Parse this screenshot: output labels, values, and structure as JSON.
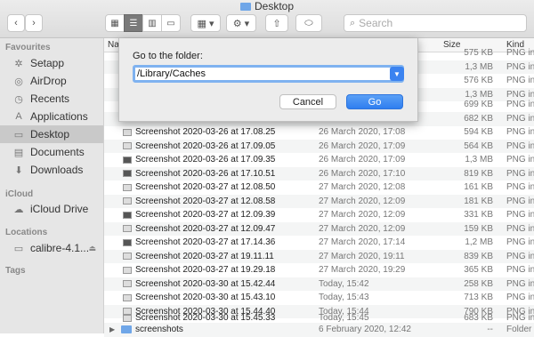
{
  "window": {
    "title": "Desktop"
  },
  "toolbar": {
    "back": "‹",
    "forward": "›",
    "search_placeholder": "Search"
  },
  "sidebar": {
    "favourites_header": "Favourites",
    "favourites": [
      {
        "label": "Setapp",
        "icon": "setapp-icon"
      },
      {
        "label": "AirDrop",
        "icon": "airdrop-icon"
      },
      {
        "label": "Recents",
        "icon": "recents-icon"
      },
      {
        "label": "Applications",
        "icon": "applications-icon"
      },
      {
        "label": "Desktop",
        "icon": "desktop-icon"
      },
      {
        "label": "Documents",
        "icon": "documents-icon"
      },
      {
        "label": "Downloads",
        "icon": "downloads-icon"
      }
    ],
    "icloud_header": "iCloud",
    "icloud_drive": "iCloud Drive",
    "locations_header": "Locations",
    "location_item": "calibre-4.1...",
    "tags_header": "Tags"
  },
  "columns": {
    "name": "Na",
    "size": "Size",
    "kind": "Kind"
  },
  "hidden_rows": [
    {
      "size": "575 KB",
      "kind": "PNG in"
    },
    {
      "size": "1,3 MB",
      "kind": "PNG in"
    },
    {
      "size": "576 KB",
      "kind": "PNG in"
    },
    {
      "size": "1,3 MB",
      "kind": "PNG in"
    },
    {
      "size": "699 KB",
      "kind": "PNG in"
    },
    {
      "size": "682 KB",
      "kind": "PNG in"
    }
  ],
  "files": [
    {
      "name": "Screenshot 2020-03-26 at 17.08.25",
      "date": "26 March 2020, 17:08",
      "size": "594 KB",
      "kind": "PNG in"
    },
    {
      "name": "Screenshot 2020-03-26 at 17.09.05",
      "date": "26 March 2020, 17:09",
      "size": "564 KB",
      "kind": "PNG in"
    },
    {
      "name": "Screenshot 2020-03-26 at 17.09.35",
      "date": "26 March 2020, 17:09",
      "size": "1,3 MB",
      "kind": "PNG in"
    },
    {
      "name": "Screenshot 2020-03-26 at 17.10.51",
      "date": "26 March 2020, 17:10",
      "size": "819 KB",
      "kind": "PNG in"
    },
    {
      "name": "Screenshot 2020-03-27 at 12.08.50",
      "date": "27 March 2020, 12:08",
      "size": "161 KB",
      "kind": "PNG in"
    },
    {
      "name": "Screenshot 2020-03-27 at 12.08.58",
      "date": "27 March 2020, 12:09",
      "size": "181 KB",
      "kind": "PNG in"
    },
    {
      "name": "Screenshot 2020-03-27 at 12.09.39",
      "date": "27 March 2020, 12:09",
      "size": "331 KB",
      "kind": "PNG in"
    },
    {
      "name": "Screenshot 2020-03-27 at 12.09.47",
      "date": "27 March 2020, 12:09",
      "size": "159 KB",
      "kind": "PNG in"
    },
    {
      "name": "Screenshot 2020-03-27 at 17.14.36",
      "date": "27 March 2020, 17:14",
      "size": "1,2 MB",
      "kind": "PNG in"
    },
    {
      "name": "Screenshot 2020-03-27 at 19.11.11",
      "date": "27 March 2020, 19:11",
      "size": "839 KB",
      "kind": "PNG in"
    },
    {
      "name": "Screenshot 2020-03-27 at 19.29.18",
      "date": "27 March 2020, 19:29",
      "size": "365 KB",
      "kind": "PNG in"
    },
    {
      "name": "Screenshot 2020-03-30 at 15.42.44",
      "date": "Today, 15:42",
      "size": "258 KB",
      "kind": "PNG in"
    },
    {
      "name": "Screenshot 2020-03-30 at 15.43.10",
      "date": "Today, 15:43",
      "size": "713 KB",
      "kind": "PNG in"
    },
    {
      "name": "Screenshot 2020-03-30 at 15.44.40",
      "date": "Today, 15:44",
      "size": "790 KB",
      "kind": "PNG in"
    },
    {
      "name": "Screenshot 2020-03-30 at 15.45.33",
      "date": "Today, 15:45",
      "size": "683 KB",
      "kind": "PNG in"
    },
    {
      "name": "screenshots",
      "date": "6 February 2020, 12:42",
      "size": "--",
      "kind": "Folder"
    }
  ],
  "sheet": {
    "prompt": "Go to the folder:",
    "path_value": "/Library/Caches",
    "cancel_label": "Cancel",
    "go_label": "Go"
  },
  "colors": {
    "accent": "#3b83f0",
    "selection": "#c9c9c9"
  }
}
